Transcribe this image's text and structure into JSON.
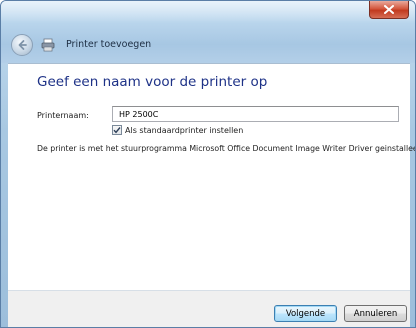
{
  "window": {
    "title": "Printer toevoegen",
    "close_icon": "close-icon",
    "back_icon": "back-arrow-icon",
    "printer_icon": "printer-icon"
  },
  "main": {
    "heading": "Geef een naam voor de printer op",
    "printer_name_label": "Printernaam:",
    "printer_name_value": "HP 2500C",
    "default_checkbox_label": "Als standaardprinter instellen",
    "default_checkbox_checked": true,
    "info_text": "De printer is met het stuurprogramma Microsoft Office Document Image Writer Driver geinstalleerd."
  },
  "footer": {
    "next_label": "Volgende",
    "cancel_label": "Annuleren"
  },
  "colors": {
    "heading": "#1e3287",
    "titlebar": "#b9d5ec",
    "close_button": "#c13a1f"
  }
}
